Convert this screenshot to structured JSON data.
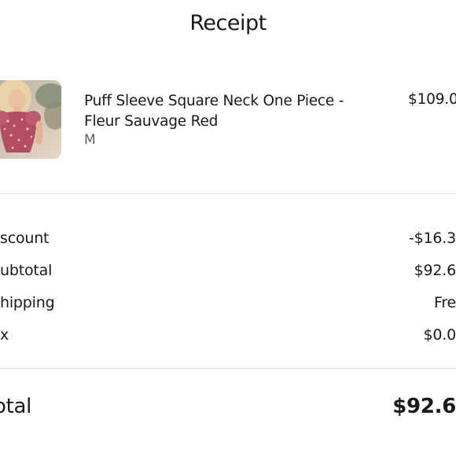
{
  "header": {
    "title": "Receipt"
  },
  "item": {
    "name": "Puff Sleeve Square Neck One Piece - Fleur Sauvage Red",
    "variant": "M",
    "price": "$109.0"
  },
  "summary": {
    "rows": [
      {
        "label": "scount",
        "value": "-$16.3"
      },
      {
        "label": "ubtotal",
        "value": "$92.6"
      },
      {
        "label": "hipping",
        "value": "Fre"
      },
      {
        "label": "x",
        "value": "$0.0"
      }
    ]
  },
  "total": {
    "label": "otal",
    "value": "$92.6"
  }
}
